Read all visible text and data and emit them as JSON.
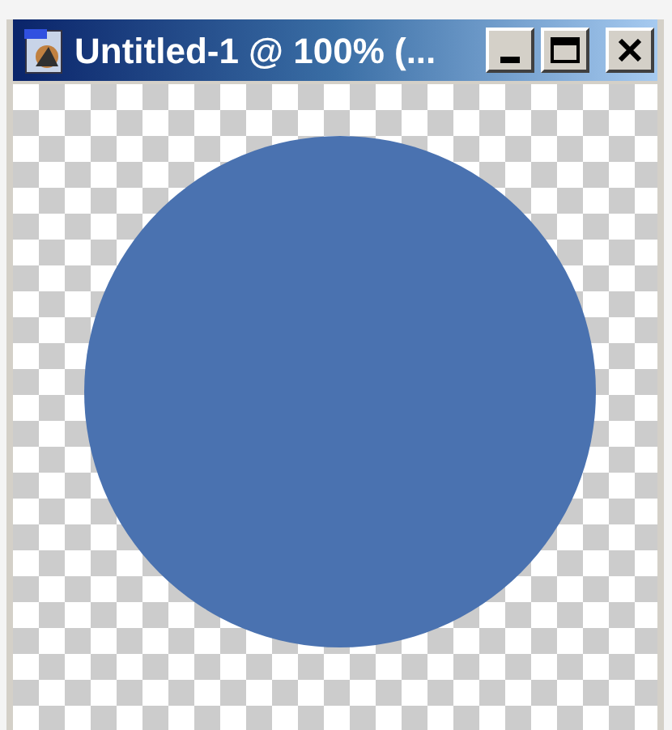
{
  "window": {
    "title": "Untitled-1 @ 100% (..."
  }
}
